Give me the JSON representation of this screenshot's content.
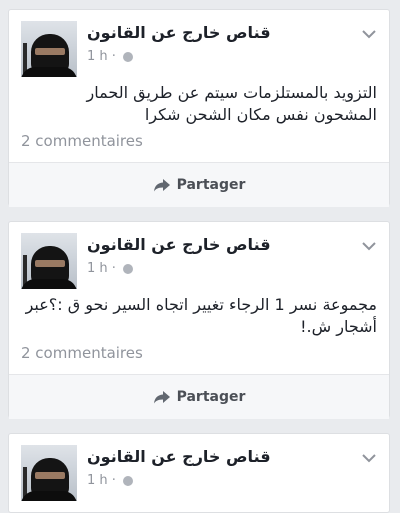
{
  "posts": [
    {
      "author": "قناص خارج عن القانون",
      "time": "1 h ·",
      "text": "التزويد بالمستلزمات سيتم عن طريق الحمار المشحون نفس مكان الشحن شكرا",
      "comments": "2 commentaires",
      "share_label": "Partager"
    },
    {
      "author": "قناص خارج عن القانون",
      "time": "1 h ·",
      "text": "مجموعة نسر 1 الرجاء تغيير اتجاه السير نحو ق :؟عبر أشجار ش.!",
      "comments": "2 commentaires",
      "share_label": "Partager"
    },
    {
      "author": "قناص خارج عن القانون",
      "time": "1 h ·"
    }
  ],
  "icons": {
    "menu": "chevron-down-icon",
    "privacy": "globe-icon",
    "share": "share-arrow-icon"
  },
  "colors": {
    "background": "#e9ebee",
    "card": "#ffffff",
    "text": "#1d2129",
    "muted": "#90949c"
  }
}
